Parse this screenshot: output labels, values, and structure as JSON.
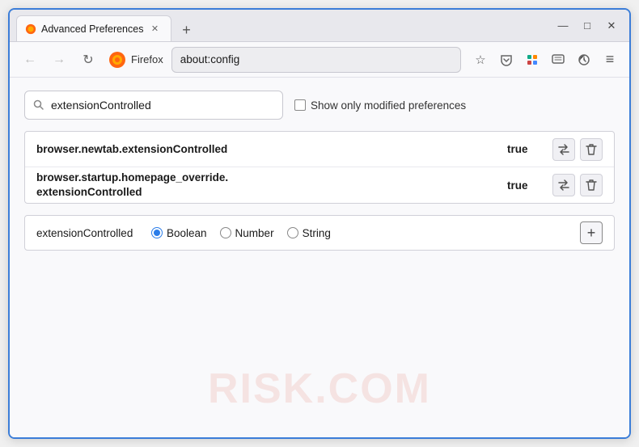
{
  "window": {
    "title": "Advanced Preferences",
    "new_tab_symbol": "+",
    "tab_close_symbol": "✕"
  },
  "window_controls": {
    "minimize": "—",
    "maximize": "□",
    "close": "✕"
  },
  "nav": {
    "back": "←",
    "forward": "→",
    "refresh": "↻",
    "browser_name": "Firefox",
    "address": "about:config",
    "bookmark_icon": "☆",
    "pocket_icon": "✓",
    "extensions_icon": "⬛",
    "account_icon": "✉",
    "back_history_icon": "⟳",
    "menu_icon": "≡"
  },
  "search": {
    "placeholder": "extensionControlled",
    "value": "extensionControlled",
    "show_modified_label": "Show only modified preferences"
  },
  "preferences": [
    {
      "name": "browser.newtab.extensionControlled",
      "value": "true"
    },
    {
      "name_line1": "browser.startup.homepage_override.",
      "name_line2": "extensionControlled",
      "value": "true"
    }
  ],
  "add_preference": {
    "name": "extensionControlled",
    "type_options": [
      "Boolean",
      "Number",
      "String"
    ],
    "selected_type": "Boolean",
    "add_symbol": "+"
  },
  "icons": {
    "search": "🔍",
    "swap": "⇌",
    "delete": "🗑",
    "radio_selected": "●",
    "radio_unselected": "○"
  },
  "watermark": "RISK.COM"
}
